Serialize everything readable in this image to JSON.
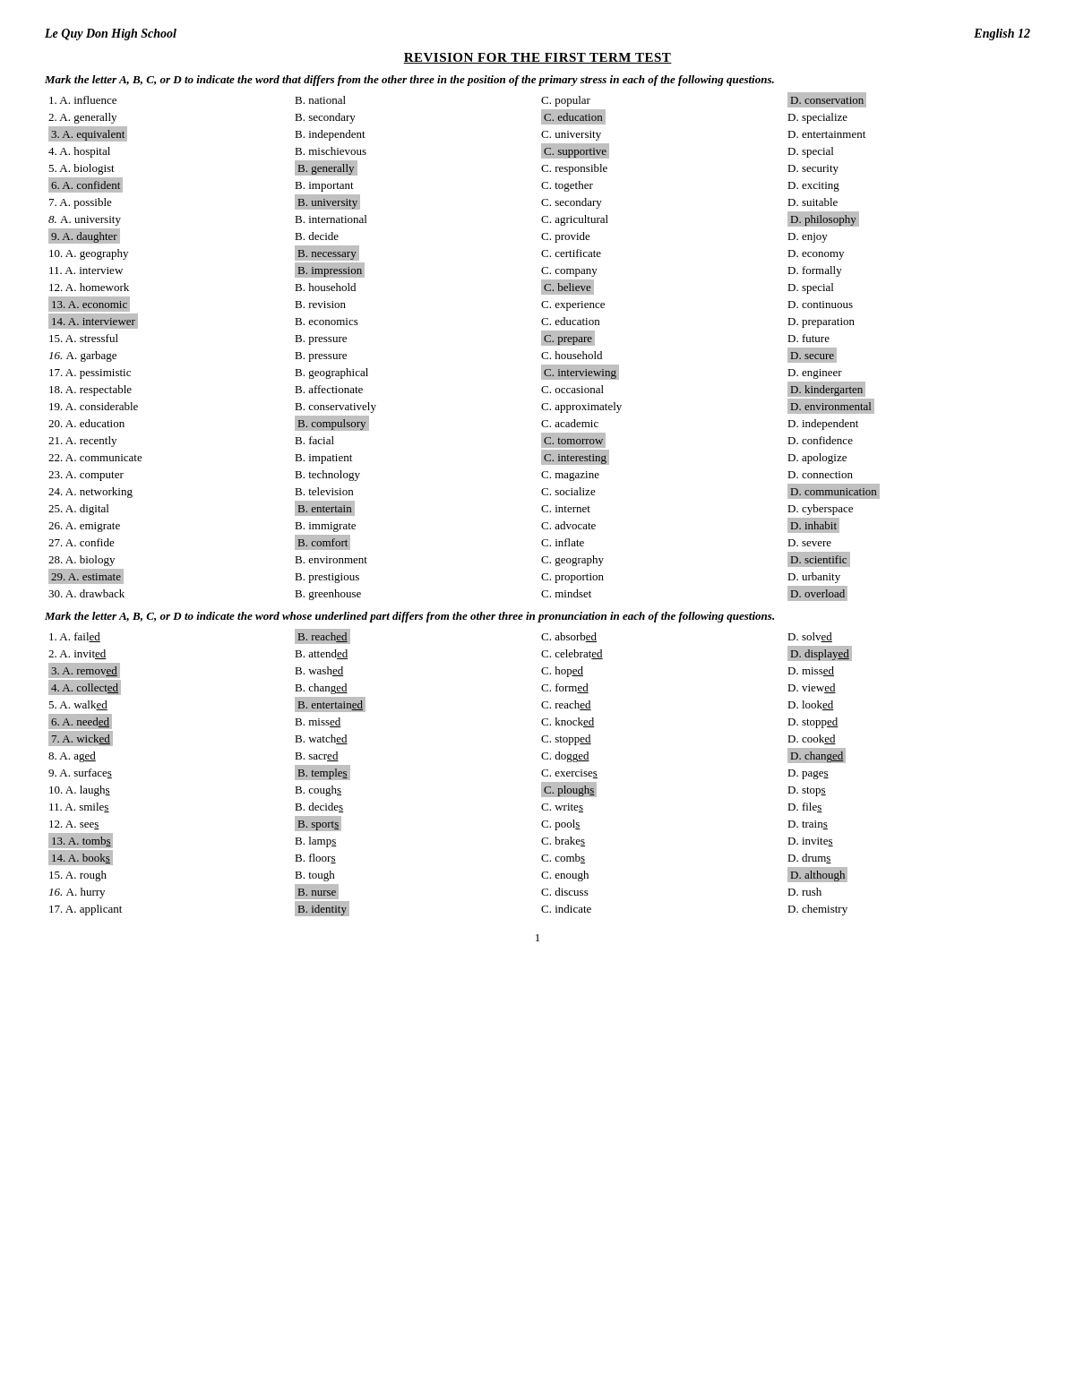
{
  "header": {
    "school": "Le Quy Don High School",
    "subject": "English 12"
  },
  "title": "REVISION FOR THE FIRST TERM TEST",
  "instruction1": "Mark the letter A, B, C, or D to indicate the word that differs from the other three in the position of the primary stress in each of the following questions.",
  "instruction2": "Mark the letter A, B, C, or D to indicate the word whose underlined part differs from the other three in pronunciation in each of the following questions.",
  "section1": [
    {
      "num": "1.",
      "a": "A. influence",
      "b": "B. national",
      "c": "C. popular",
      "d": "D. conservation",
      "ha": false,
      "hb": false,
      "hc": false,
      "hd": true
    },
    {
      "num": "2.",
      "a": "A. generally",
      "b": "B. secondary",
      "c": "C. education",
      "d": "D. specialize",
      "ha": false,
      "hb": false,
      "hc": true,
      "hd": false
    },
    {
      "num": "3.",
      "a": "A. equivalent",
      "b": "B. independent",
      "c": "C. university",
      "d": "D. entertainment",
      "ha": true,
      "hb": false,
      "hc": false,
      "hd": false
    },
    {
      "num": "4.",
      "a": "A. hospital",
      "b": "B. mischievous",
      "c": "C. supportive",
      "d": "D. special",
      "ha": false,
      "hb": false,
      "hc": true,
      "hd": false
    },
    {
      "num": "5.",
      "a": "A. biologist",
      "b": "B. generally",
      "c": "C. responsible",
      "d": "D. security",
      "ha": false,
      "hb": true,
      "hc": false,
      "hd": false
    },
    {
      "num": "6.",
      "a": "A. confident",
      "b": "B. important",
      "c": "C. together",
      "d": "D. exciting",
      "ha": true,
      "hb": false,
      "hc": false,
      "hd": false
    },
    {
      "num": "7.",
      "a": "A. possible",
      "b": "B. university",
      "c": "C. secondary",
      "d": "D. suitable",
      "ha": false,
      "hb": true,
      "hc": false,
      "hd": false
    },
    {
      "num": "8.",
      "a": "A. university",
      "b": "B. international",
      "c": "C. agricultural",
      "d": "D. philosophy",
      "ha": false,
      "hb": false,
      "hc": false,
      "hd": true,
      "italic": true
    },
    {
      "num": "9.",
      "a": "A. daughter",
      "b": "B. decide",
      "c": "C. provide",
      "d": "D. enjoy",
      "ha": true,
      "hb": false,
      "hc": false,
      "hd": false
    },
    {
      "num": "10.",
      "a": "A. geography",
      "b": "B. necessary",
      "c": "C. certificate",
      "d": "D. economy",
      "ha": false,
      "hb": true,
      "hc": false,
      "hd": false
    },
    {
      "num": "11.",
      "a": "A. interview",
      "b": "B. impression",
      "c": "C. company",
      "d": "D. formally",
      "ha": false,
      "hb": true,
      "hc": false,
      "hd": false
    },
    {
      "num": "12.",
      "a": "A. homework",
      "b": "B. household",
      "c": "C. believe",
      "d": "D. special",
      "ha": false,
      "hb": false,
      "hc": true,
      "hd": false
    },
    {
      "num": "13.",
      "a": "A. economic",
      "b": "B. revision",
      "c": "C. experience",
      "d": "D. continuous",
      "ha": true,
      "hb": false,
      "hc": false,
      "hd": false
    },
    {
      "num": "14.",
      "a": "A. interviewer",
      "b": "B. economics",
      "c": "C. education",
      "d": "D. preparation",
      "ha": true,
      "hb": false,
      "hc": false,
      "hd": false
    },
    {
      "num": "15.",
      "a": "A. stressful",
      "b": "B. pressure",
      "c": "C. prepare",
      "d": "D. future",
      "ha": false,
      "hb": false,
      "hc": true,
      "hd": false
    },
    {
      "num": "16.",
      "a": "A. garbage",
      "b": "B. pressure",
      "c": "C. household",
      "d": "D. secure",
      "ha": false,
      "hb": false,
      "hc": false,
      "hd": true,
      "italic": true
    },
    {
      "num": "17.",
      "a": "A. pessimistic",
      "b": "B. geographical",
      "c": "C. interviewing",
      "d": "D. engineer",
      "ha": false,
      "hb": false,
      "hc": true,
      "hd": false
    },
    {
      "num": "18.",
      "a": "A. respectable",
      "b": "B. affectionate",
      "c": "C. occasional",
      "d": "D. kindergarten",
      "ha": false,
      "hb": false,
      "hc": false,
      "hd": true
    },
    {
      "num": "19.",
      "a": "A. considerable",
      "b": "B. conservatively",
      "c": "C. approximately",
      "d": "D. environmental",
      "ha": false,
      "hb": false,
      "hc": false,
      "hd": true
    },
    {
      "num": "20.",
      "a": "A. education",
      "b": "B. compulsory",
      "c": "C. academic",
      "d": "D. independent",
      "ha": false,
      "hb": true,
      "hc": false,
      "hd": false
    },
    {
      "num": "21.",
      "a": "A. recently",
      "b": "B. facial",
      "c": "C. tomorrow",
      "d": "D. confidence",
      "ha": false,
      "hb": false,
      "hc": true,
      "hd": false
    },
    {
      "num": "22.",
      "a": "A. communicate",
      "b": "B. impatient",
      "c": "C. interesting",
      "d": "D. apologize",
      "ha": false,
      "hb": false,
      "hc": true,
      "hd": false
    },
    {
      "num": "23.",
      "a": "A. computer",
      "b": "B. technology",
      "c": "C. magazine",
      "d": "D. connection",
      "ha": false,
      "hb": false,
      "hc": false,
      "hd": false
    },
    {
      "num": "24.",
      "a": "A. networking",
      "b": "B. television",
      "c": "C. socialize",
      "d": "D. communication",
      "ha": false,
      "hb": false,
      "hc": false,
      "hd": true
    },
    {
      "num": "25.",
      "a": "A. digital",
      "b": "B. entertain",
      "c": "C. internet",
      "d": "D. cyberspace",
      "ha": false,
      "hb": true,
      "hc": false,
      "hd": false
    },
    {
      "num": "26.",
      "a": "A. emigrate",
      "b": "B. immigrate",
      "c": "C. advocate",
      "d": "D. inhabit",
      "ha": false,
      "hb": false,
      "hc": false,
      "hd": true
    },
    {
      "num": "27.",
      "a": "A. confide",
      "b": "B. comfort",
      "c": "C. inflate",
      "d": "D. severe",
      "ha": false,
      "hb": true,
      "hc": false,
      "hd": false
    },
    {
      "num": "28.",
      "a": "A. biology",
      "b": "B. environment",
      "c": "C. geography",
      "d": "D. scientific",
      "ha": false,
      "hb": false,
      "hc": false,
      "hd": true
    },
    {
      "num": "29.",
      "a": "A. estimate",
      "b": "B. prestigious",
      "c": "C. proportion",
      "d": "D. urbanity",
      "ha": true,
      "hb": false,
      "hc": false,
      "hd": false
    },
    {
      "num": "30.",
      "a": "A. drawback",
      "b": "B. greenhouse",
      "c": "C. mindset",
      "d": "D. overload",
      "ha": false,
      "hb": false,
      "hc": false,
      "hd": true
    }
  ],
  "section2": [
    {
      "num": "1.",
      "a": "A. fail<u>ed</u>",
      "b": "B. reach<u>ed</u>",
      "c": "C. absorb<u>ed</u>",
      "d": "D. solv<u>ed</u>",
      "ha": false,
      "hb": true,
      "hc": false,
      "hd": false,
      "au": "failed",
      "bu": "reached",
      "cu": "absorbed",
      "du": "solved"
    },
    {
      "num": "2.",
      "a": "A. invit<u>ed</u>",
      "b": "B. attend<u>ed</u>",
      "c": "C. celebrat<u>ed</u>",
      "d": "D. display<u>ed</u>",
      "ha": false,
      "hb": false,
      "hc": false,
      "hd": true
    },
    {
      "num": "3.",
      "a": "A. remov<u>ed</u>",
      "b": "B. wash<u>ed</u>",
      "c": "C. hop<u>ed</u>",
      "d": "D. miss<u>ed</u>",
      "ha": true,
      "hb": false,
      "hc": false,
      "hd": false
    },
    {
      "num": "4.",
      "a": "A. collect<u>ed</u>",
      "b": "B. chang<u>ed</u>",
      "c": "C. form<u>ed</u>",
      "d": "D. view<u>ed</u>",
      "ha": true,
      "hb": false,
      "hc": false,
      "hd": false
    },
    {
      "num": "5.",
      "a": "A. walk<u>ed</u>",
      "b": "B. entertain<u>ed</u>",
      "c": "C. reach<u>ed</u>",
      "d": "D. look<u>ed</u>",
      "ha": false,
      "hb": true,
      "hc": false,
      "hd": false
    },
    {
      "num": "6.",
      "a": "A. need<u>ed</u>",
      "b": "B. miss<u>ed</u>",
      "c": "C. knock<u>ed</u>",
      "d": "D. stopp<u>ed</u>",
      "ha": true,
      "hb": false,
      "hc": false,
      "hd": false
    },
    {
      "num": "7.",
      "a": "A. wick<u>ed</u>",
      "b": "B. watch<u>ed</u>",
      "c": "C. stopp<u>ed</u>",
      "d": "D. cook<u>ed</u>",
      "ha": true,
      "hb": false,
      "hc": false,
      "hd": false
    },
    {
      "num": "8.",
      "a": "A. ag<u>ed</u>",
      "b": "B. sacr<u>ed</u>",
      "c": "C. dogg<u>ed</u>",
      "d": "D. chang<u>ed</u>",
      "ha": false,
      "hb": false,
      "hc": false,
      "hd": true
    },
    {
      "num": "9.",
      "a": "A. surface<u>s</u>",
      "b": "B. temple<u>s</u>",
      "c": "C. exercise<u>s</u>",
      "d": "D. page<u>s</u>",
      "ha": false,
      "hb": true,
      "hc": false,
      "hd": false
    },
    {
      "num": "10.",
      "a": "A. laugh<u>s</u>",
      "b": "B. cough<u>s</u>",
      "c": "C. plough<u>s</u>",
      "d": "D. stop<u>s</u>",
      "ha": false,
      "hb": false,
      "hc": true,
      "hd": false
    },
    {
      "num": "11.",
      "a": "A. smile<u>s</u>",
      "b": "B. decide<u>s</u>",
      "c": "C. write<u>s</u>",
      "d": "D. file<u>s</u>",
      "ha": false,
      "hb": false,
      "hc": false,
      "hd": false
    },
    {
      "num": "12.",
      "a": "A. see<u>s</u>",
      "b": "B. sport<u>s</u>",
      "c": "C. pool<u>s</u>",
      "d": "D. train<u>s</u>",
      "ha": false,
      "hb": true,
      "hc": false,
      "hd": false
    },
    {
      "num": "13.",
      "a": "A. tomb<u>s</u>",
      "b": "B. lamp<u>s</u>",
      "c": "C. brake<u>s</u>",
      "d": "D. invite<u>s</u>",
      "ha": true,
      "hb": false,
      "hc": false,
      "hd": false
    },
    {
      "num": "14.",
      "a": "A. book<u>s</u>",
      "b": "B. floor<u>s</u>",
      "c": "C. comb<u>s</u>",
      "d": "D. drum<u>s</u>",
      "ha": true,
      "hb": false,
      "hc": false,
      "hd": false
    },
    {
      "num": "15.",
      "a": "A. rough",
      "b": "B. tough",
      "c": "C. enough",
      "d": "D. although",
      "ha": false,
      "hb": false,
      "hc": false,
      "hd": true
    },
    {
      "num": "16.",
      "a": "A. hurry",
      "b": "B. nurse",
      "c": "C. discuss",
      "d": "D. rush",
      "ha": false,
      "hb": true,
      "hc": false,
      "hd": false,
      "italic": true
    },
    {
      "num": "17.",
      "a": "A. applicant",
      "b": "B. identity",
      "c": "C. indicate",
      "d": "D. chemistry",
      "ha": false,
      "hb": true,
      "hc": false,
      "hd": false
    }
  ],
  "footer": "1"
}
